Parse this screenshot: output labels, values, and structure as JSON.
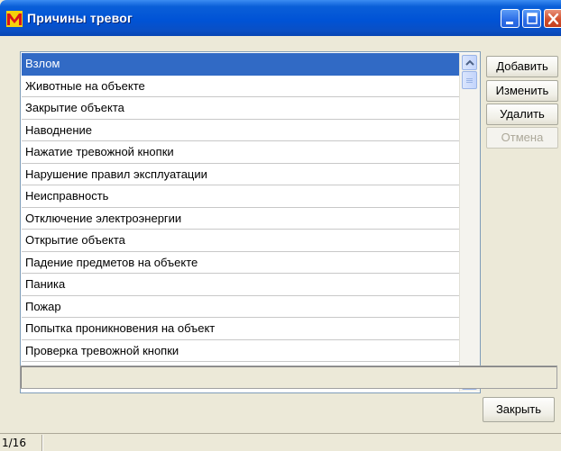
{
  "window": {
    "title": "Причины тревог",
    "app_icon": "app-logo-icon",
    "controls": [
      "minimize-icon",
      "maximize-icon",
      "close-icon"
    ]
  },
  "list": {
    "items": [
      {
        "label": "Взлом",
        "selected": true
      },
      {
        "label": "Животные на объекте",
        "selected": false
      },
      {
        "label": "Закрытие объекта",
        "selected": false
      },
      {
        "label": "Наводнение",
        "selected": false
      },
      {
        "label": "Нажатие тревожной кнопки",
        "selected": false
      },
      {
        "label": "Нарушение правил эксплуатации",
        "selected": false
      },
      {
        "label": "Неисправность",
        "selected": false
      },
      {
        "label": "Отключение электроэнергии",
        "selected": false
      },
      {
        "label": "Открытие объекта",
        "selected": false
      },
      {
        "label": "Падение предметов на объекте",
        "selected": false
      },
      {
        "label": "Паника",
        "selected": false
      },
      {
        "label": "Пожар",
        "selected": false
      },
      {
        "label": "Попытка проникновения на объект",
        "selected": false
      },
      {
        "label": "Проверка тревожной кнопки",
        "selected": false
      }
    ]
  },
  "buttons": {
    "add": "Добавить",
    "edit": "Изменить",
    "delete": "Удалить",
    "cancel": "Отмена",
    "close": "Закрыть"
  },
  "edit_field": {
    "value": ""
  },
  "status": {
    "position": "1/16"
  },
  "colors": {
    "titlebar": "#0053d6",
    "selection": "#316ac5",
    "window_bg": "#ece9d8"
  }
}
